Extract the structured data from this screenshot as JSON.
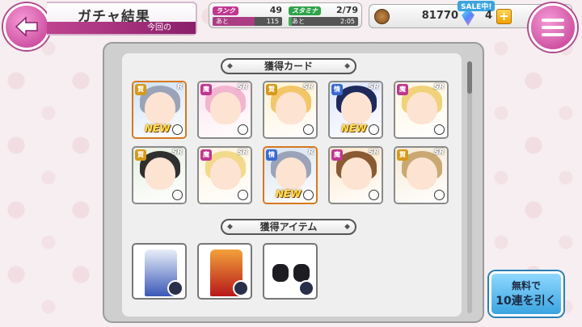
{
  "header": {
    "title": "ガチャ結果",
    "subtitle": "今回の"
  },
  "status": {
    "rank_label": "ランク",
    "rank_value": "49",
    "rank_next_label": "あと",
    "rank_next_value": "115",
    "stamina_label": "スタミナ",
    "stamina_value": "2/79",
    "stamina_next_label": "あと",
    "stamina_next_value": "2:05"
  },
  "currency": {
    "coins": "81770",
    "sale_label": "SALE中!",
    "gems": "4",
    "plus_label": "+"
  },
  "cards_section": {
    "title": "獲得カード"
  },
  "cards": [
    {
      "rarity": "R",
      "attr": "賢",
      "attr_color": "#d59a1a",
      "new": "NEW",
      "hair": "#9aa3b8",
      "bg": "#cfe1f5",
      "frame": "rare-R"
    },
    {
      "rarity": "SR",
      "attr": "魔",
      "attr_color": "#c0378f",
      "new": "",
      "hair": "#f2b5cf",
      "bg": "#fde2ee",
      "frame": "rare-SR"
    },
    {
      "rarity": "SR",
      "attr": "賢",
      "attr_color": "#d59a1a",
      "new": "",
      "hair": "#f3c66a",
      "bg": "#fff1d6",
      "frame": "rare-SR"
    },
    {
      "rarity": "SR",
      "attr": "情",
      "attr_color": "#3a6ad2",
      "new": "NEW",
      "hair": "#1e2a5c",
      "bg": "#dde5ff",
      "frame": "rare-SR"
    },
    {
      "rarity": "SR",
      "attr": "魔",
      "attr_color": "#c0378f",
      "new": "",
      "hair": "#f0d27a",
      "bg": "#fff6e2",
      "frame": "rare-SR"
    },
    {
      "rarity": "SR",
      "attr": "賢",
      "attr_color": "#d59a1a",
      "new": "",
      "hair": "#2f2f2f",
      "bg": "#e6f0e0",
      "frame": "rare-SR"
    },
    {
      "rarity": "SR",
      "attr": "魔",
      "attr_color": "#c0378f",
      "new": "",
      "hair": "#f3d98a",
      "bg": "#fff3de",
      "frame": "rare-SR"
    },
    {
      "rarity": "R",
      "attr": "情",
      "attr_color": "#3a6ad2",
      "new": "NEW",
      "hair": "#9aa3b8",
      "bg": "#d7e3f0",
      "frame": "rare-R"
    },
    {
      "rarity": "SR",
      "attr": "魔",
      "attr_color": "#c0378f",
      "new": "",
      "hair": "#8a5a33",
      "bg": "#fde6c8",
      "frame": "rare-SR"
    },
    {
      "rarity": "SR",
      "attr": "賢",
      "attr_color": "#d59a1a",
      "new": "",
      "hair": "#c9a873",
      "bg": "#f5ead6",
      "frame": "rare-SR"
    }
  ],
  "items_section": {
    "title": "獲得アイテム"
  },
  "items": [
    {
      "name": "kimono-outfit",
      "color_a": "#e8eef8",
      "color_b": "#3a58b8",
      "portrait": true
    },
    {
      "name": "red-dress-outfit",
      "color_a": "#f2a13a",
      "color_b": "#b8181a",
      "portrait": true
    },
    {
      "name": "black-gloves",
      "color_a": "#ffffff",
      "color_b": "#1c1c22",
      "portrait": true
    }
  ],
  "gacha_button": {
    "line1": "無料で",
    "line2": "10連を引く"
  }
}
